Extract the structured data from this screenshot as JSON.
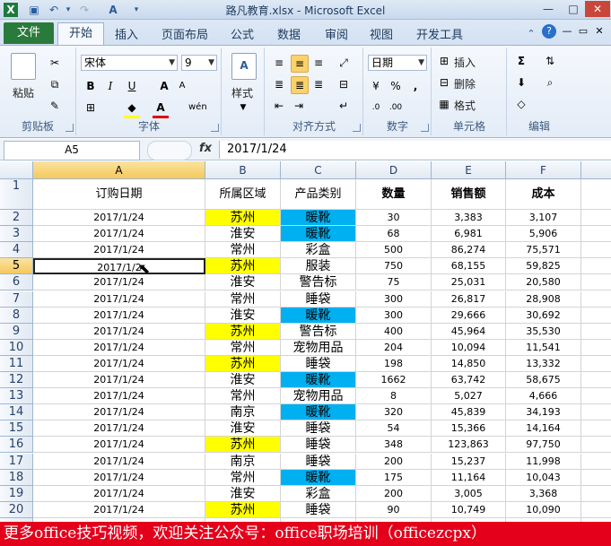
{
  "window": {
    "title": "路凡教育.xlsx - Microsoft Excel"
  },
  "quick_access": {
    "icons": [
      "excel-logo-icon",
      "save-icon",
      "undo-icon",
      "redo-icon",
      "font-color-icon"
    ]
  },
  "tabs": [
    "文件",
    "开始",
    "插入",
    "页面布局",
    "公式",
    "数据",
    "审阅",
    "视图",
    "开发工具"
  ],
  "active_tab": "开始",
  "ribbon": {
    "clipboard": {
      "label": "剪贴板",
      "paste": "粘贴"
    },
    "font": {
      "label": "字体",
      "font_name": "宋体",
      "font_size": "9",
      "bold": "B",
      "italic": "I",
      "underline": "U",
      "grow": "A",
      "shrink": "A"
    },
    "styles": {
      "label": "样式"
    },
    "alignment": {
      "label": "对齐方式"
    },
    "number": {
      "label": "数字",
      "format": "日期",
      "percent": "%",
      "comma": ","
    },
    "cells": {
      "label": "单元格",
      "insert": "插入",
      "delete": "删除",
      "format": "格式"
    },
    "editing": {
      "label": "编辑",
      "sum": "Σ"
    }
  },
  "formula_bar": {
    "name_box": "A5",
    "fx": "fx",
    "content": "2017/1/24"
  },
  "columns": [
    "A",
    "B",
    "C",
    "D",
    "E",
    "F"
  ],
  "header_row": {
    "row": "1",
    "cells": [
      "订购日期",
      "所属区域",
      "产品类别",
      "数量",
      "销售额",
      "成本"
    ]
  },
  "rows": [
    {
      "row": "2",
      "cells": [
        "2017/1/24",
        "苏州",
        "暖靴",
        "30",
        "3,383",
        "3,107"
      ]
    },
    {
      "row": "3",
      "cells": [
        "2017/1/24",
        "淮安",
        "暖靴",
        "68",
        "6,981",
        "5,906"
      ]
    },
    {
      "row": "4",
      "cells": [
        "2017/1/24",
        "常州",
        "彩盒",
        "500",
        "86,274",
        "75,571"
      ]
    },
    {
      "row": "5",
      "cells": [
        "2017/1/2",
        "苏州",
        "服装",
        "750",
        "68,155",
        "59,825"
      ]
    },
    {
      "row": "6",
      "cells": [
        "2017/1/24",
        "淮安",
        "警告标",
        "75",
        "25,031",
        "20,580"
      ]
    },
    {
      "row": "7",
      "cells": [
        "2017/1/24",
        "常州",
        "睡袋",
        "300",
        "26,817",
        "28,908"
      ]
    },
    {
      "row": "8",
      "cells": [
        "2017/1/24",
        "淮安",
        "暖靴",
        "300",
        "29,666",
        "30,692"
      ]
    },
    {
      "row": "9",
      "cells": [
        "2017/1/24",
        "苏州",
        "警告标",
        "400",
        "45,964",
        "35,530"
      ]
    },
    {
      "row": "10",
      "cells": [
        "2017/1/24",
        "常州",
        "宠物用品",
        "204",
        "10,094",
        "11,541"
      ]
    },
    {
      "row": "11",
      "cells": [
        "2017/1/24",
        "苏州",
        "睡袋",
        "198",
        "14,850",
        "13,332"
      ]
    },
    {
      "row": "12",
      "cells": [
        "2017/1/24",
        "淮安",
        "暖靴",
        "1662",
        "63,742",
        "58,675"
      ]
    },
    {
      "row": "13",
      "cells": [
        "2017/1/24",
        "常州",
        "宠物用品",
        "8",
        "5,027",
        "4,666"
      ]
    },
    {
      "row": "14",
      "cells": [
        "2017/1/24",
        "南京",
        "暖靴",
        "320",
        "45,839",
        "34,193"
      ]
    },
    {
      "row": "15",
      "cells": [
        "2017/1/24",
        "淮安",
        "睡袋",
        "54",
        "15,366",
        "14,164"
      ]
    },
    {
      "row": "16",
      "cells": [
        "2017/1/24",
        "苏州",
        "睡袋",
        "348",
        "123,863",
        "97,750"
      ]
    },
    {
      "row": "17",
      "cells": [
        "2017/1/24",
        "南京",
        "睡袋",
        "200",
        "15,237",
        "11,998"
      ]
    },
    {
      "row": "18",
      "cells": [
        "2017/1/24",
        "常州",
        "暖靴",
        "175",
        "11,164",
        "10,043"
      ]
    },
    {
      "row": "19",
      "cells": [
        "2017/1/24",
        "淮安",
        "彩盒",
        "200",
        "3,005",
        "3,368"
      ]
    },
    {
      "row": "20",
      "cells": [
        "2017/1/24",
        "苏州",
        "睡袋",
        "90",
        "10,749",
        "10,090"
      ]
    }
  ],
  "highlight": {
    "yellow_rows": [
      "2",
      "5",
      "9",
      "11",
      "16",
      "20"
    ],
    "blue_rows": [
      "2",
      "3",
      "8",
      "12",
      "14",
      "18"
    ],
    "yellow": "#ffff00",
    "blue": "#00b0f0"
  },
  "active_cell": "A5",
  "banner": {
    "text": "更多office技巧视频，欢迎关注公众号：office职场培训（officezcpx）"
  }
}
